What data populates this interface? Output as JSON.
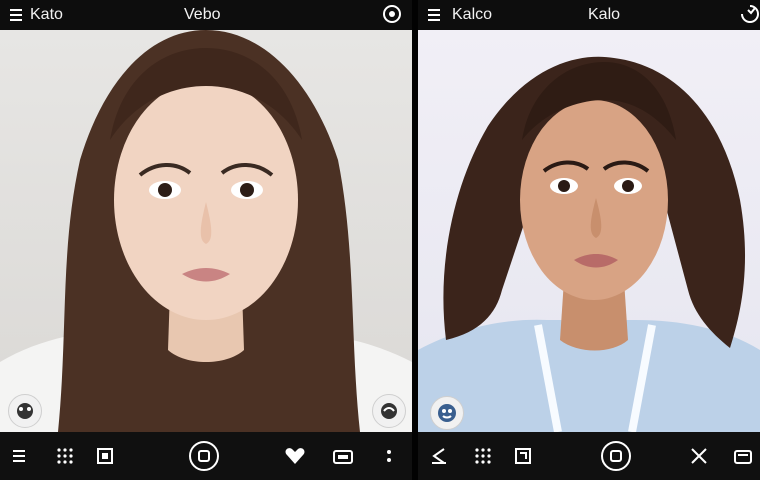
{
  "left_panel": {
    "topbar": {
      "app_name": "Kato",
      "center_text": "Vebo"
    }
  },
  "right_panel": {
    "topbar": {
      "app_name": "Kalco",
      "center_text": "Kalo"
    }
  },
  "icons": {
    "menu": "hamburger-menu-icon",
    "options": "settings-icon",
    "grid": "grid-dots-icon",
    "home": "home-square-icon",
    "record": "record-button-icon",
    "heart": "heart-icon",
    "camera": "camera-icon",
    "more": "more-dots-icon",
    "back": "back-arrow-icon",
    "close": "close-x-icon",
    "folder": "folder-icon",
    "sticker": "sticker-icon"
  },
  "colors": {
    "bar_bg": "#0d0d0d",
    "left_bg": "#e2e1df",
    "right_bg": "#efeff5",
    "white_shirt": "#f4f4f3",
    "blue_shirt": "#bcd1e8"
  }
}
